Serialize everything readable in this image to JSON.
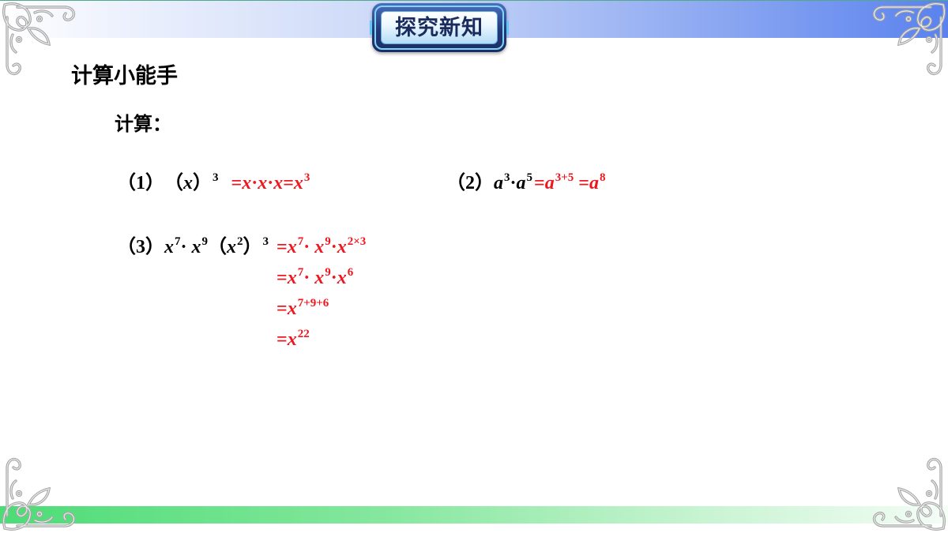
{
  "slide": {
    "badge_title": "探究新知",
    "section_title": "计算小能手",
    "prompt": "计算："
  },
  "colors": {
    "text": "#000000",
    "answer": "#f0161e",
    "badge_text": "#1a2c5e",
    "header_bar_left": "#ffffff",
    "header_bar_right": "#5a82ee",
    "footer_bar_left": "#4ddc76",
    "footer_bar_right": "#f4fdf6",
    "ornament": "#a8a8a8"
  },
  "problems": [
    {
      "label": "（1）",
      "question": [
        {
          "t": "（"
        },
        {
          "t": "x",
          "var": true
        },
        {
          "t": "）"
        },
        {
          "t": "3",
          "sup": true
        }
      ],
      "answer_lines": [
        [
          {
            "t": "="
          },
          {
            "t": "x",
            "var": true
          },
          {
            "t": "·"
          },
          {
            "t": "x",
            "var": true
          },
          {
            "t": "·"
          },
          {
            "t": "x",
            "var": true
          },
          {
            "t": "="
          },
          {
            "t": "x",
            "var": true
          },
          {
            "t": "3",
            "sup": true
          }
        ]
      ]
    },
    {
      "label": "（2）",
      "question": [
        {
          "t": "a",
          "var": true
        },
        {
          "t": "3",
          "sup": true
        },
        {
          "t": "·"
        },
        {
          "t": "a",
          "var": true
        },
        {
          "t": "5",
          "sup": true
        }
      ],
      "answer_lines": [
        [
          {
            "t": "="
          },
          {
            "t": "a",
            "var": true
          },
          {
            "t": "3+5",
            "sup": true
          },
          {
            "t": " ="
          },
          {
            "t": "a",
            "var": true
          },
          {
            "t": "8",
            "sup": true
          }
        ]
      ]
    },
    {
      "label": "（3）",
      "question": [
        {
          "t": "x",
          "var": true
        },
        {
          "t": "7",
          "sup": true
        },
        {
          "t": "· "
        },
        {
          "t": "x",
          "var": true
        },
        {
          "t": "9",
          "sup": true
        },
        {
          "t": "（"
        },
        {
          "t": "x",
          "var": true
        },
        {
          "t": "2",
          "sup": true
        },
        {
          "t": "）"
        },
        {
          "t": "3",
          "sup": true
        }
      ],
      "answer_lines": [
        [
          {
            "t": "="
          },
          {
            "t": "x",
            "var": true
          },
          {
            "t": "7",
            "sup": true
          },
          {
            "t": "· "
          },
          {
            "t": "x",
            "var": true
          },
          {
            "t": "9",
            "sup": true
          },
          {
            "t": "·"
          },
          {
            "t": "x",
            "var": true
          },
          {
            "t": "2×3",
            "sup": true
          }
        ],
        [
          {
            "t": "="
          },
          {
            "t": "x",
            "var": true
          },
          {
            "t": "7",
            "sup": true
          },
          {
            "t": "· "
          },
          {
            "t": "x",
            "var": true
          },
          {
            "t": "9",
            "sup": true
          },
          {
            "t": "·"
          },
          {
            "t": "x",
            "var": true
          },
          {
            "t": "6",
            "sup": true
          }
        ],
        [
          {
            "t": "="
          },
          {
            "t": "x",
            "var": true
          },
          {
            "t": "7+9+6",
            "sup": true
          }
        ],
        [
          {
            "t": "="
          },
          {
            "t": "x",
            "var": true
          },
          {
            "t": "22",
            "sup": true
          }
        ]
      ]
    }
  ]
}
